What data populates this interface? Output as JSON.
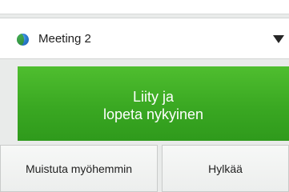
{
  "meeting_selector": {
    "label": "Meeting 2",
    "icon": "globe-icon",
    "dropdown_icon": "triangle-down-icon"
  },
  "join_button": {
    "label": "Liity ja\nlopeta nykyinen",
    "color": "#3aa822"
  },
  "actions": {
    "remind_label": "Muistuta myöhemmin",
    "decline_label": "Hylkää"
  }
}
